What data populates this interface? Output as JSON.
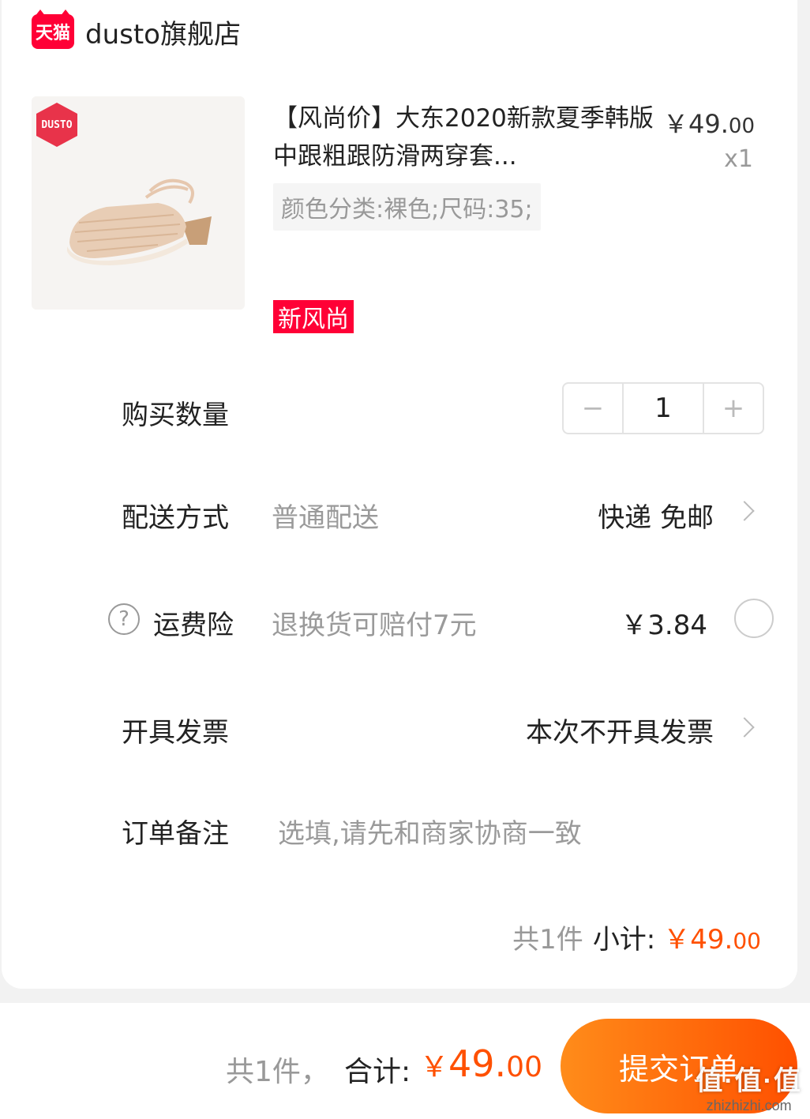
{
  "store": {
    "badge": "天猫",
    "name": "dusto旗舰店"
  },
  "product": {
    "brand_logo": "DUSTO",
    "title": "【风尚价】大东2020新款夏季韩版中跟粗跟防滑两穿套...",
    "price_int": "￥49.",
    "price_dec": "00",
    "quantity_label": "x1",
    "sku": "颜色分类:裸色;尺码:35;",
    "tag": "新风尚"
  },
  "quantity": {
    "label": "购买数量",
    "minus": "−",
    "value": "1",
    "plus": "+"
  },
  "delivery": {
    "label": "配送方式",
    "sub": "普通配送",
    "value": "快递 免邮"
  },
  "insurance": {
    "label": "运费险",
    "sub": "退换货可赔付7元",
    "price": "￥3.84"
  },
  "invoice": {
    "label": "开具发票",
    "value": "本次不开具发票"
  },
  "note": {
    "label": "订单备注",
    "placeholder": "选填,请先和商家协商一致"
  },
  "subtotal": {
    "count": "共1件",
    "label": "小计:",
    "amount_int": "￥49.",
    "amount_dec": "00"
  },
  "footer": {
    "count": "共1件，",
    "label": "合计:",
    "currency": "￥",
    "amount_int": "49.",
    "amount_dec": "00",
    "submit": "提交订单"
  },
  "watermark": {
    "big": "值·值·值",
    "small": "zhizhizhi.com"
  },
  "colors": {
    "tmall_red": "#ff0036",
    "price_orange": "#ff5000",
    "button_gradient_start": "#ff8c1a"
  }
}
